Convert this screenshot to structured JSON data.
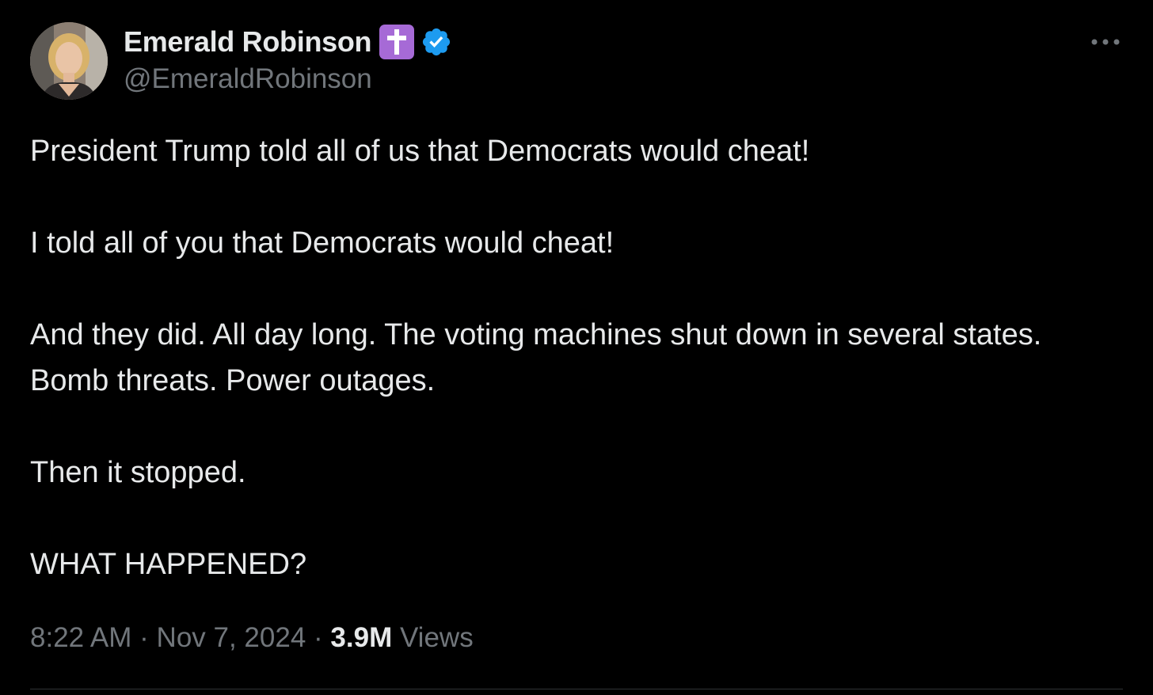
{
  "author": {
    "display_name": "Emerald Robinson",
    "handle": "@EmeraldRobinson",
    "badge_emoji_icon": "latin-cross-emoji",
    "verified_icon": "verified-badge-icon",
    "verified_color": "#1d9bf0"
  },
  "tweet": {
    "paragraphs": [
      "President Trump told all of us that Democrats would cheat!",
      "I told all of you that Democrats would cheat!",
      "And they did. All day long. The voting machines shut down in several states. Bomb threats. Power outages.",
      "Then it stopped.",
      "WHAT HAPPENED?"
    ]
  },
  "meta": {
    "time": "8:22 AM",
    "separator": "·",
    "date": "Nov 7, 2024",
    "views_count": "3.9M",
    "views_label": "Views"
  },
  "menu": {
    "more_icon": "more-horizontal-icon"
  },
  "colors": {
    "background": "#000000",
    "text_primary": "#e7e9ea",
    "text_secondary": "#71767b",
    "divider": "#2f3336",
    "cross_badge_bg": "#a66ad6"
  }
}
